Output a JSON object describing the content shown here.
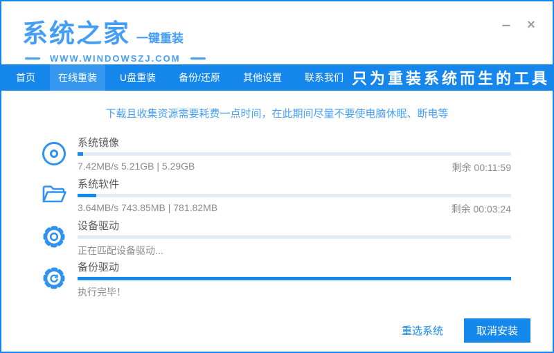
{
  "window": {
    "logo": "系统之家",
    "logo_sub": "一键重装",
    "website": "WWW.WINDOWSZJ.COM",
    "minimize": "–",
    "close": "×"
  },
  "nav": {
    "items": [
      {
        "label": "首页",
        "active": false
      },
      {
        "label": "在线重装",
        "active": true
      },
      {
        "label": "U盘重装",
        "active": false
      },
      {
        "label": "备份/还原",
        "active": false
      },
      {
        "label": "其他设置",
        "active": false
      },
      {
        "label": "联系我们",
        "active": false
      }
    ],
    "slogan": "只为重装系统而生的工具"
  },
  "notice": "下载且收集资源需要耗费一点时间，在此期间尽量不要使电脑休眠、断电等",
  "tasks": [
    {
      "icon": "disc-icon",
      "label": "系统镜像",
      "progress": 1.3,
      "status": "7.42MB/s 5.21GB | 5.29GB",
      "remaining": "剩余 00:11:59"
    },
    {
      "icon": "folder-icon",
      "label": "系统软件",
      "progress": 4.3,
      "status": "3.64MB/s 743.85MB | 781.82MB",
      "remaining": "剩余 00:03:24"
    },
    {
      "icon": "gear-icon",
      "label": "设备驱动",
      "progress": 0,
      "status": "正在匹配设备驱动...",
      "remaining": ""
    },
    {
      "icon": "gear-sync-icon",
      "label": "备份驱动",
      "progress": 100,
      "status": "执行完毕！",
      "remaining": ""
    }
  ],
  "footer": {
    "reselect": "重选系统",
    "cancel": "取消安装"
  },
  "colors": {
    "accent": "#1588ec",
    "nav_active": "#3697ee",
    "logo_blue": "#459ef5",
    "bar_track": "#e3ebf5",
    "label_gray": "#595959",
    "status_gray": "#8c8c8c"
  }
}
